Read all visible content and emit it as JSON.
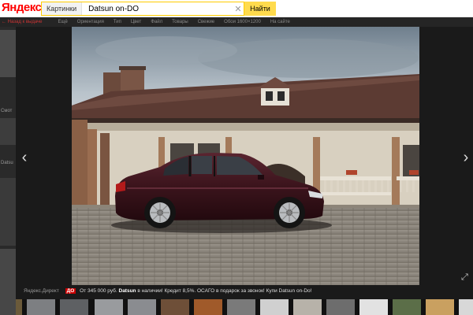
{
  "header": {
    "logo": "Яндекс",
    "search_chip": "Картинки",
    "search_query": "Datsun on-DO",
    "find_button": "Найти"
  },
  "filters": [
    "← Назад к выдаче",
    "Ещё",
    "Ориентация",
    "Тип",
    "Цвет",
    "Файл",
    "Товары",
    "Свежие",
    "Обои 1600×1200",
    "На сайте"
  ],
  "left_strip": {
    "labels": [
      "Смот",
      "Datsu"
    ]
  },
  "viewer": {
    "prev_arrow": "‹",
    "next_arrow": "›",
    "expand_icon": "⤢"
  },
  "ad": {
    "label": "Яндекс.Директ",
    "badge": "ДО",
    "price": "От 345 000 руб.",
    "brand": "Datsun",
    "text": "в наличии! Кредит 8,5%. ОСАГО в подарок за звонок! Купи",
    "link": "Datsun on-Do!"
  }
}
